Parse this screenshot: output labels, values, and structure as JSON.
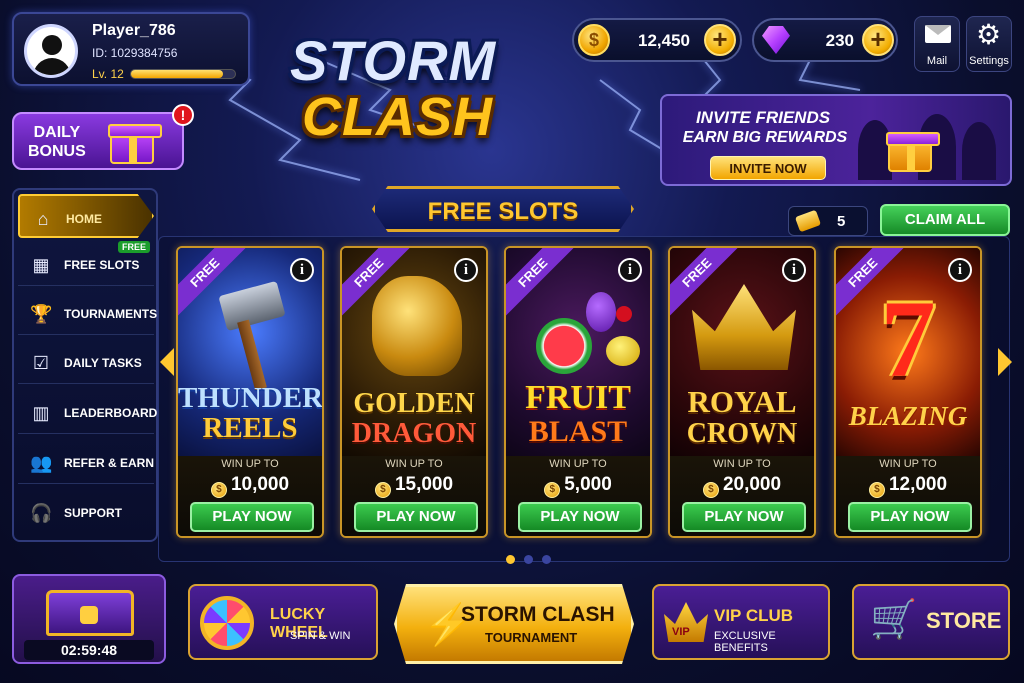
{
  "player": {
    "name": "Player_786",
    "id": "ID: 1029384756",
    "level": "Lv. 12",
    "xp_progress": 0.88
  },
  "currency": {
    "coins": "12,450",
    "gems": "230",
    "plus": "+"
  },
  "top_buttons": {
    "mail": "Mail",
    "settings": "Settings"
  },
  "logo": {
    "line1": "STORM",
    "line2": "CLASH"
  },
  "daily_bonus": {
    "label": "DAILY BONUS",
    "line1": "DAILY",
    "line2": "BONUS",
    "alert": "!"
  },
  "invite": {
    "line1": "INVITE FRIENDS",
    "line2": "EARN BIG REWARDS",
    "button": "INVITE NOW"
  },
  "sidebar": {
    "items": [
      {
        "label": "HOME",
        "icon": "home-icon",
        "glyph": "⌂"
      },
      {
        "label": "FREE SLOTS",
        "icon": "slot-machine-icon",
        "glyph": "▦",
        "badge": "FREE"
      },
      {
        "label": "TOURNAMENTS",
        "icon": "trophy-icon",
        "glyph": "🏆"
      },
      {
        "label": "DAILY TASKS",
        "icon": "clipboard-check-icon",
        "glyph": "☑"
      },
      {
        "label": "LEADERBOARD",
        "icon": "podium-icon",
        "glyph": "▥"
      },
      {
        "label": "REFER & EARN",
        "icon": "users-icon",
        "glyph": "👥"
      },
      {
        "label": "SUPPORT",
        "icon": "headset-icon",
        "glyph": "🎧"
      }
    ]
  },
  "free_slots": {
    "title": "FREE SLOTS",
    "tickets": "5",
    "claim_all": "CLAIM ALL"
  },
  "games": [
    {
      "tag": "FREE",
      "title1": "THUNDER",
      "title2": "REELS",
      "win_label": "WIN UP TO",
      "amount": "10,000",
      "play": "PLAY NOW",
      "info": "i"
    },
    {
      "tag": "FREE",
      "title1": "GOLDEN",
      "title2": "DRAGON",
      "win_label": "WIN UP TO",
      "amount": "15,000",
      "play": "PLAY NOW",
      "info": "i"
    },
    {
      "tag": "FREE",
      "title1": "FRUIT",
      "title2": "BLAST",
      "win_label": "WIN UP TO",
      "amount": "5,000",
      "play": "PLAY NOW",
      "info": "i"
    },
    {
      "tag": "FREE",
      "title1": "ROYAL",
      "title2": "CROWN",
      "win_label": "WIN UP TO",
      "amount": "20,000",
      "play": "PLAY NOW",
      "info": "i"
    },
    {
      "tag": "FREE",
      "title1": "7",
      "title2": "BLAZING",
      "win_label": "WIN UP TO",
      "amount": "12,000",
      "play": "PLAY NOW",
      "info": "i"
    }
  ],
  "carousel": {
    "page": 1,
    "pages": 3
  },
  "bottom": {
    "chest_timer": "02:59:48",
    "lucky_title": "LUCKY WHEEL",
    "lucky_sub": "SPIN & WIN",
    "tourn_title": "STORM CLASH",
    "tourn_sub": "TOURNAMENT",
    "vip_badge": "VIP",
    "vip_title": "VIP CLUB",
    "vip_sub": "EXCLUSIVE BENEFITS",
    "store": "STORE"
  },
  "colors": {
    "accent_gold": "#ffc730",
    "play_green": "#1f9c30",
    "purple": "#7a2ed0",
    "bg": "#0a0e2c"
  }
}
